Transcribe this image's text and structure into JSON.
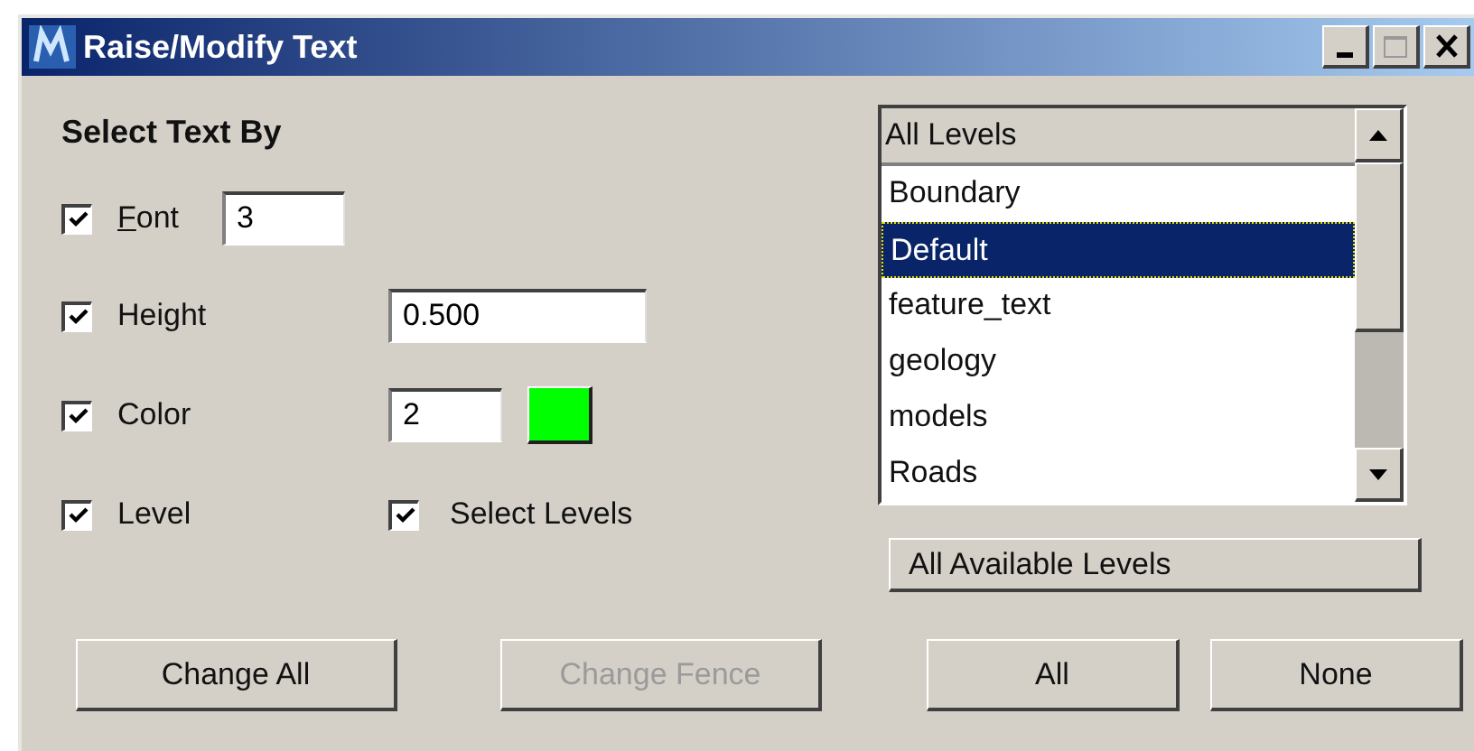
{
  "window": {
    "title": "Raise/Modify Text"
  },
  "section_title": "Select Text By",
  "criteria": [
    {
      "kind": "inline_field",
      "label": "Font",
      "mnemonic": true,
      "checked": true,
      "value": "3"
    },
    {
      "kind": "field",
      "label": "Height",
      "mnemonic": false,
      "checked": true,
      "value": "0.500"
    },
    {
      "kind": "color_field",
      "label": "Color",
      "mnemonic": false,
      "checked": true,
      "value": "2",
      "color": "#00ff00"
    },
    {
      "kind": "checkbox_pair",
      "label": "Level",
      "mnemonic": false,
      "checked": true,
      "second": {
        "label": "Select Levels",
        "checked": true
      }
    }
  ],
  "levels_list": {
    "header": "All Levels",
    "items": [
      {
        "label": "Boundary",
        "selected": false
      },
      {
        "label": "Default",
        "selected": true
      },
      {
        "label": "feature_text",
        "selected": false
      },
      {
        "label": "geology",
        "selected": false
      },
      {
        "label": "models",
        "selected": false
      },
      {
        "label": "Roads",
        "selected": false
      }
    ]
  },
  "levels_button": "All Available Levels",
  "buttons": [
    {
      "label": "Change All",
      "disabled": false
    },
    {
      "label": "Change Fence",
      "disabled": true
    },
    {
      "label": "All",
      "disabled": false
    },
    {
      "label": "None",
      "disabled": false
    }
  ]
}
